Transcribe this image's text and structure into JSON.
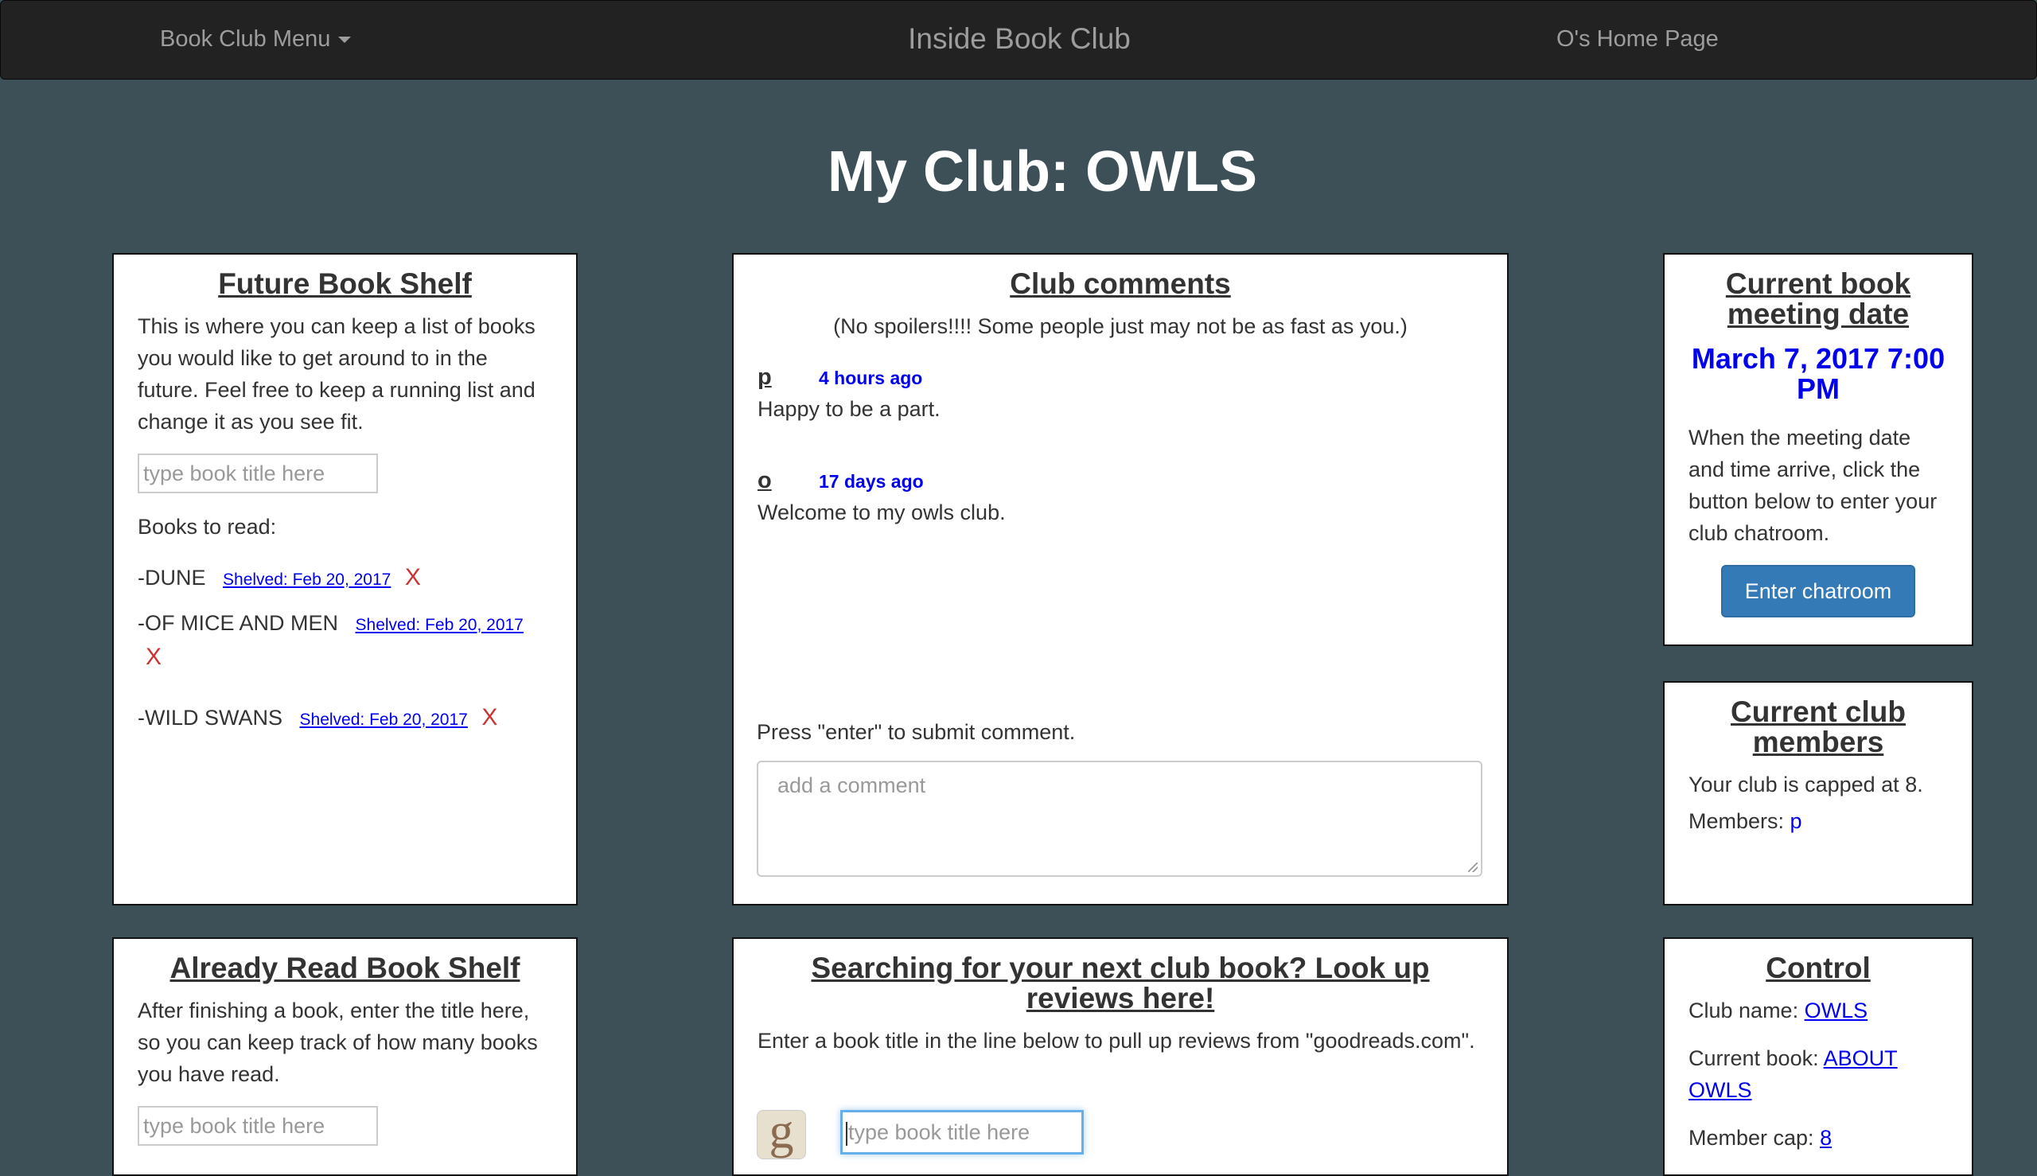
{
  "nav": {
    "menu_label": "Book Club Menu",
    "brand": "Inside Book Club",
    "home_link": "O's Home Page"
  },
  "page_title": "My Club: OWLS",
  "future_shelf": {
    "title": "Future Book Shelf",
    "description": "This is where you can keep a list of books you would like to get around to in the future. Feel free to keep a running list and change it as you see fit.",
    "input_placeholder": "type book title here",
    "list_label": "Books to read:",
    "books": [
      {
        "title": "-DUNE",
        "shelved": "Shelved: Feb 20, 2017",
        "remove": "X"
      },
      {
        "title": "-OF MICE AND MEN",
        "shelved": "Shelved: Feb 20, 2017",
        "remove": "X"
      },
      {
        "title": "-WILD SWANS",
        "shelved": "Shelved: Feb 20, 2017",
        "remove": "X"
      }
    ]
  },
  "comments": {
    "title": "Club comments",
    "note": "(No spoilers!!!! Some people just may not be as fast as you.)",
    "items": [
      {
        "author": "p",
        "time": "4 hours ago",
        "text": "Happy to be a part."
      },
      {
        "author": "o",
        "time": "17 days ago",
        "text": "Welcome to my owls club."
      }
    ],
    "hint": "Press \"enter\" to submit comment.",
    "input_placeholder": "add a comment"
  },
  "meeting": {
    "title": "Current book meeting date",
    "date": "March 7, 2017 7:00 PM",
    "description": "When the meeting date and time arrive, click the button below to enter your club chatroom.",
    "button": "Enter chatroom"
  },
  "members": {
    "title": "Current club members",
    "cap_text": "Your club is capped at 8.",
    "members_label": "Members:",
    "member": "p"
  },
  "read_shelf": {
    "title": "Already Read Book Shelf",
    "description": "After finishing a book, enter the title here, so you can keep track of how many books you have read.",
    "input_placeholder": "type book title here"
  },
  "search": {
    "title": "Searching for your next club book? Look up reviews here!",
    "description": "Enter a book title in the line below to pull up reviews from \"goodreads.com\".",
    "icon_letter": "g",
    "input_placeholder": "type book title here"
  },
  "control": {
    "title": "Control",
    "club_name_label": "Club name:",
    "club_name": "OWLS",
    "current_book_label": "Current book:",
    "current_book": "ABOUT OWLS",
    "member_cap_label": "Member cap:",
    "member_cap": "8"
  }
}
